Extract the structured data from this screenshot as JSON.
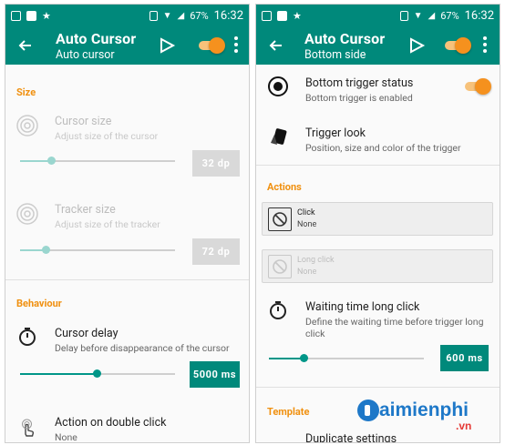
{
  "status_bar": {
    "battery": "67%",
    "time": "16:32"
  },
  "left": {
    "title": "Auto Cursor",
    "subtitle": "Auto cursor",
    "section_size": "Size",
    "cursor_size": {
      "title": "Cursor size",
      "subtitle": "Adjust size of the cursor",
      "value": "32 dp",
      "fraction": 0.2
    },
    "tracker_size": {
      "title": "Tracker size",
      "subtitle": "Adjust size of the tracker",
      "value": "72 dp",
      "fraction": 0.17
    },
    "section_behaviour": "Behaviour",
    "cursor_delay": {
      "title": "Cursor delay",
      "subtitle": "Delay before disappearance of the cursor",
      "value": "5000 ms",
      "fraction": 0.5
    },
    "double_click": {
      "title": "Action on double click",
      "subtitle": "None"
    }
  },
  "right": {
    "title": "Auto Cursor",
    "subtitle": "Bottom side",
    "trigger_status": {
      "title": "Bottom trigger status",
      "subtitle": "Bottom trigger is enabled"
    },
    "trigger_look": {
      "title": "Trigger look",
      "subtitle": "Position, size and color of the trigger"
    },
    "section_actions": "Actions",
    "click": {
      "label": "Click",
      "value": "None"
    },
    "long_click": {
      "label": "Long click",
      "value": "None"
    },
    "waiting_time": {
      "title": "Waiting time long click",
      "subtitle": "Define the waiting time before trigger long click",
      "value": "600 ms",
      "fraction": 0.23
    },
    "section_template": "Template",
    "duplicate": {
      "title": "Duplicate settings"
    }
  },
  "watermark": {
    "brand": "aimienphi",
    "tld": ".vn"
  },
  "colors": {
    "primary": "#00897b",
    "accent": "#f5911e",
    "section": "#f0900f"
  }
}
